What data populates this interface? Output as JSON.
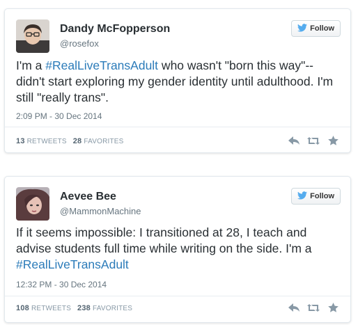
{
  "tweets": [
    {
      "name": "Dandy McFopperson",
      "handle": "@rosefox",
      "follow_label": "Follow",
      "text_before": "I'm a ",
      "hashtag": "#RealLiveTransAdult",
      "text_after": " who wasn't \"born this way\"--didn't start exploring my gender identity until adulthood. I'm still \"really trans\".",
      "timestamp": "2:09 PM - 30 Dec 2014",
      "retweets": "13",
      "retweets_label": "RETWEETS",
      "favorites": "28",
      "favorites_label": "FAVORITES"
    },
    {
      "name": "Aevee Bee",
      "handle": "@MammonMachine",
      "follow_label": "Follow",
      "text_before": "If it seems impossible: I transitioned at 28, I teach and advise students full time while writing on the side. I'm a ",
      "hashtag": "#RealLiveTransAdult",
      "text_after": "",
      "timestamp": "12:32 PM - 30 Dec 2014",
      "retweets": "108",
      "retweets_label": "RETWEETS",
      "favorites": "238",
      "favorites_label": "FAVORITES"
    }
  ],
  "icons": {
    "follow": "twitter-bird-icon",
    "reply": "reply-icon",
    "retweet": "retweet-icon",
    "favorite": "star-icon"
  },
  "colors": {
    "link": "#2b7bb9",
    "twitter_blue": "#55acee",
    "action_gray": "#8899a6"
  }
}
